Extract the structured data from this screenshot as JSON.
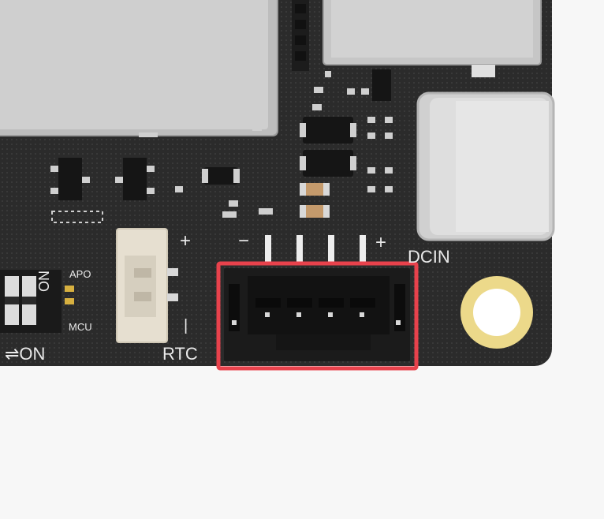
{
  "labels": {
    "rtc": "RTC",
    "dcin": "DCIN",
    "apo": "APO",
    "mcu": "MCU",
    "on": "ON",
    "switch_on": "⇌ON",
    "plus": "+",
    "minus": "−",
    "rtc_plus": "+",
    "rtc_minus": "|"
  },
  "colors": {
    "board": "#2b2b2b",
    "highlight": "#e8424c",
    "mounting_ring": "#ecd98a",
    "metal": "#c9c9c9",
    "rtc_connector": "#e6dfd0"
  }
}
